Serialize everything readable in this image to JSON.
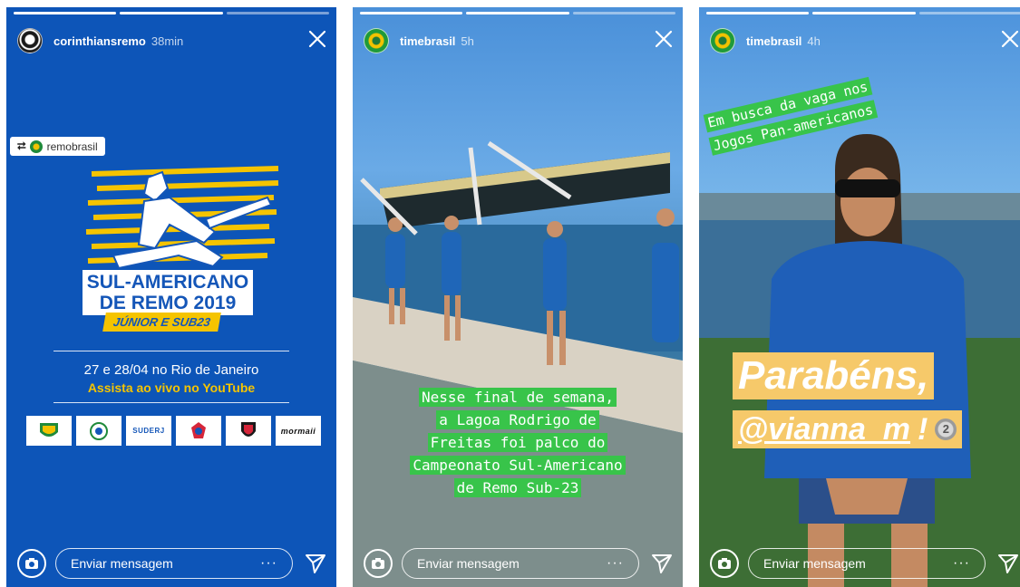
{
  "stories": [
    {
      "username": "corinthiansremo",
      "time": "38min",
      "regram": {
        "label": "remobrasil"
      },
      "poster": {
        "title_line1": "SUL-AMERICANO",
        "title_line2": "DE REMO 2019",
        "subtitle": "JÚNIOR E SUB23",
        "dates": "27 e 28/04 no Rio de Janeiro",
        "watch": "Assista ao vivo no YouTube",
        "sponsors": [
          "",
          "",
          "SUDERJ",
          "",
          "",
          "mormaii"
        ]
      },
      "message_placeholder": "Enviar mensagem"
    },
    {
      "username": "timebrasil",
      "time": "5h",
      "caption_lines": [
        "Nesse final de semana,",
        "a Lagoa Rodrigo de",
        "Freitas foi palco do",
        "Campeonato Sul-Americano",
        "de Remo Sub-23"
      ],
      "message_placeholder": "Enviar mensagem"
    },
    {
      "username": "timebrasil",
      "time": "4h",
      "caption_lines": [
        "Em busca da vaga nos",
        "Jogos Pan-americanos"
      ],
      "congrats": "Parabéns,",
      "mention": "@vianna_m",
      "mention_suffix": "!",
      "medal": "2",
      "message_placeholder": "Enviar mensagem"
    }
  ],
  "icons": {
    "more": "···",
    "close": "close-icon",
    "camera": "camera-icon",
    "send": "send-icon"
  }
}
